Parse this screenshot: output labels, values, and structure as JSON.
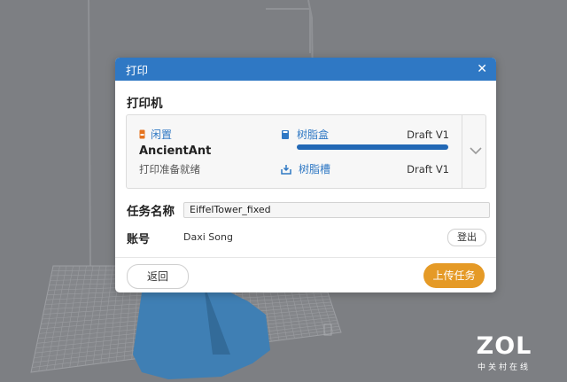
{
  "dialog": {
    "title": "打印",
    "printer_section_title": "打印机",
    "printer": {
      "status": "闲置",
      "name": "AncientAnt",
      "sub_status": "打印准备就绪"
    },
    "resources": [
      {
        "label": "树脂盒",
        "version": "Draft V1",
        "progress": 1.0
      },
      {
        "label": "树脂槽",
        "version": "Draft V1"
      }
    ],
    "job": {
      "label": "任务名称",
      "value": "EiffelTower_fixed"
    },
    "account": {
      "label": "账号",
      "value": "Daxi Song",
      "logout_label": "登出"
    },
    "buttons": {
      "back": "返回",
      "upload": "上传任务"
    }
  },
  "watermark": {
    "logo": "ZOL",
    "subtitle": "中关村在线"
  },
  "colors": {
    "title_bar": "#2f78c4",
    "accent_orange": "#e59a26",
    "status_orange": "#e5731f",
    "backdrop": "#7d7f83"
  }
}
